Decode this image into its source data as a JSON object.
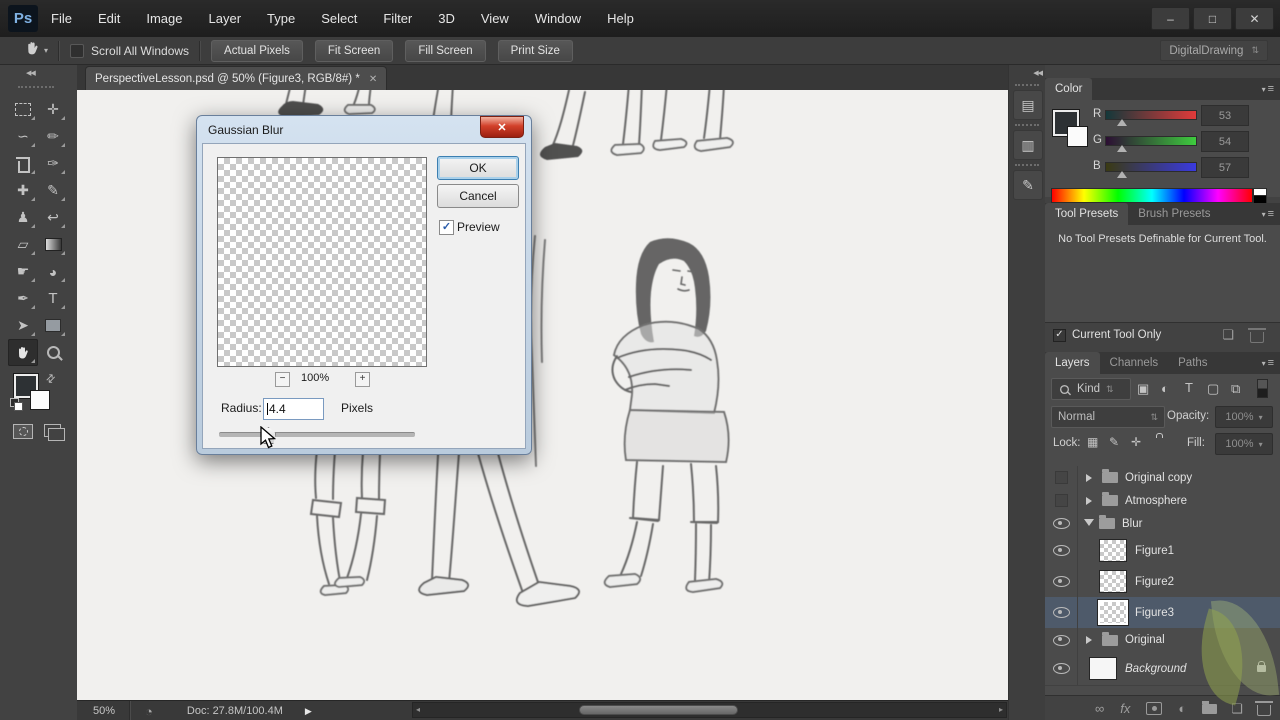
{
  "window": {
    "logo": "Ps",
    "menu": [
      "File",
      "Edit",
      "Image",
      "Layer",
      "Type",
      "Select",
      "Filter",
      "3D",
      "View",
      "Window",
      "Help"
    ]
  },
  "options_bar": {
    "scroll_all_windows": "Scroll All Windows",
    "actual_pixels": "Actual Pixels",
    "fit_screen": "Fit Screen",
    "fill_screen": "Fill Screen",
    "print_size": "Print Size",
    "workspace": "DigitalDrawing"
  },
  "document": {
    "tab": "PerspectiveLesson.psd @ 50% (Figure3, RGB/8#) *",
    "zoom": "50%",
    "doc_size": "Doc: 27.8M/100.4M"
  },
  "dialog": {
    "title": "Gaussian Blur",
    "ok": "OK",
    "cancel": "Cancel",
    "preview": "Preview",
    "zoom_level": "100%",
    "radius_label": "Radius:",
    "radius_value": "4.4",
    "unit": "Pixels"
  },
  "color_panel": {
    "tab": "Color",
    "channels": [
      {
        "label": "R",
        "value": "53"
      },
      {
        "label": "G",
        "value": "54"
      },
      {
        "label": "B",
        "value": "57"
      }
    ],
    "accent_colors": {
      "r_track_end": "#e03a3a",
      "g_track_end": "#3ecc3e",
      "b_track_end": "#3a3ae0"
    }
  },
  "presets_panel": {
    "tab_tool": "Tool Presets",
    "tab_brush": "Brush Presets",
    "message": "No Tool Presets Definable for Current Tool.",
    "current_tool_only": "Current Tool Only"
  },
  "layers_panel": {
    "tab_layers": "Layers",
    "tab_channels": "Channels",
    "tab_paths": "Paths",
    "kind": "Kind",
    "blend_mode": "Normal",
    "opacity_label": "Opacity:",
    "opacity": "100%",
    "lock_label": "Lock:",
    "fill_label": "Fill:",
    "fill": "100%",
    "layers": [
      {
        "name": "Original copy"
      },
      {
        "name": "Atmosphere"
      },
      {
        "name": "Blur"
      },
      {
        "name": "Figure1"
      },
      {
        "name": "Figure2"
      },
      {
        "name": "Figure3"
      },
      {
        "name": "Original"
      },
      {
        "name": "Background"
      }
    ]
  },
  "icons": {
    "move": "✛",
    "lasso": "∽",
    "quick_select": "✏",
    "eyedropper": "✑",
    "healing": "✚",
    "brush": "✎",
    "clone_stamp": "♟",
    "history_brush": "↩",
    "eraser": "▱",
    "smudge": "☛",
    "dodge": "◕",
    "pen": "✒",
    "type_tool": "T",
    "path_select": "➤",
    "swap": "⇄",
    "caret_down": "▾",
    "updown": "⇅",
    "collapse_left": "◀◀",
    "panel_menu": "≡",
    "minus": "−",
    "plus": "+",
    "close": "✕",
    "win_min": "–",
    "win_max": "□",
    "history_panel": "▤",
    "clone_panel": "▥",
    "brush_panel": "✎",
    "pixel_filter": "▣",
    "adj_filter": "◐",
    "type_filter": "T",
    "shape_filter": "▢",
    "smart_filter": "⧉",
    "lock_checker": "▦",
    "lock_brush": "✎",
    "lock_move": "✛",
    "fx": "fx",
    "adjustment": "◐",
    "new_item": "❏",
    "link": "∞",
    "status_arrow": "▶",
    "clock": "◔",
    "scroll_left": "◂",
    "scroll_right": "▸",
    "scroll_up": "▴",
    "scroll_down": "▾"
  }
}
